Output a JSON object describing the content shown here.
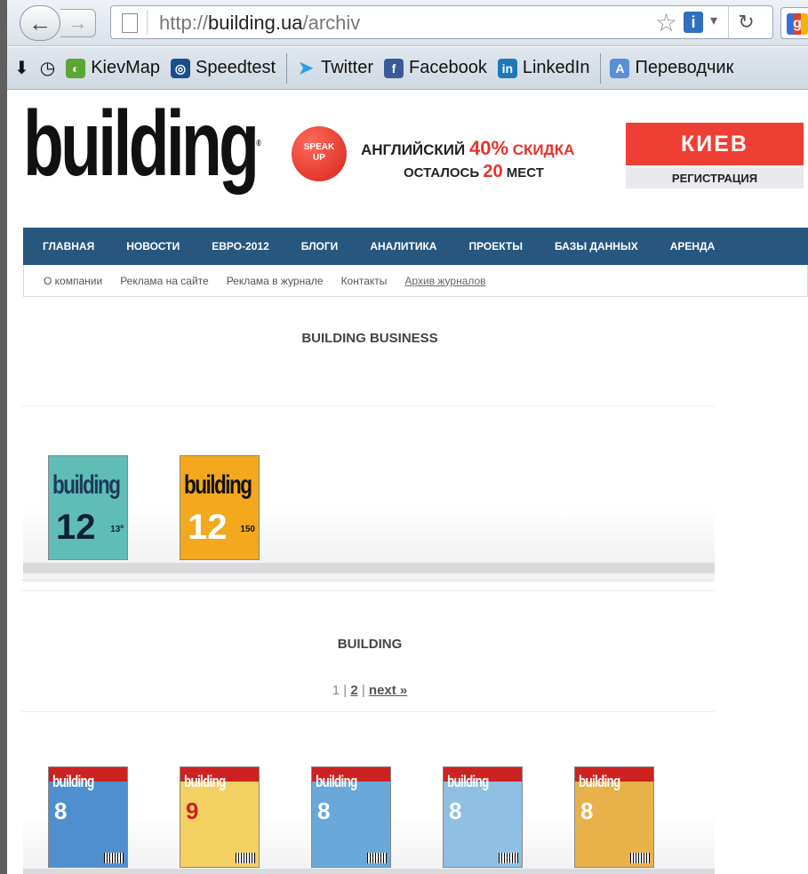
{
  "browser": {
    "url_prefix": "http://",
    "url_domain": "building.ua",
    "url_path": "/archiv",
    "bookmarks": [
      {
        "label": "KievMap",
        "icon": "kievmap-icon"
      },
      {
        "label": "Speedtest",
        "icon": "speedtest-icon"
      },
      {
        "label": "Twitter",
        "icon": "twitter-icon"
      },
      {
        "label": "Facebook",
        "icon": "facebook-icon"
      },
      {
        "label": "LinkedIn",
        "icon": "linkedin-icon"
      },
      {
        "label": "Переводчик",
        "icon": "translate-icon"
      }
    ]
  },
  "site": {
    "logo": "building",
    "banner": {
      "badge_line1": "SPEAK",
      "badge_line2": "UP",
      "line1_a": "АНГЛИЙСКИЙ",
      "line1_discount": "40%",
      "line1_b": "СКИДКА",
      "line2_a": "ОСТАЛОСЬ",
      "line2_num": "20",
      "line2_b": "МЕСТ",
      "city": "КИЕВ",
      "register": "РЕГИСТРАЦИЯ"
    },
    "main_nav": [
      "ГЛАВНАЯ",
      "НОВОСТИ",
      "ЕВРО-2012",
      "БЛОГИ",
      "АНАЛИТИКА",
      "ПРОЕКТЫ",
      "БАЗЫ ДАННЫХ",
      "АРЕНДА"
    ],
    "sub_nav": [
      "О компании",
      "Реклама на сайте",
      "Реклама в журнале",
      "Контакты",
      "Архив журналов"
    ],
    "active_sub_nav": "Архив журналов"
  },
  "sections": {
    "business_title": "BUILDING BUSINESS",
    "business_mags": [
      {
        "title": "building",
        "number": "12",
        "price": "13º",
        "color": "#5fbcb6"
      },
      {
        "title": "building",
        "number": "12",
        "price": "150",
        "color": "#f3a81d"
      }
    ],
    "building_title": "BUILDING",
    "pager": {
      "page1": "1",
      "sep1": "|",
      "page2": "2",
      "sep2": "|",
      "next": "next »"
    },
    "building_mags": [
      {
        "title": "building",
        "number": "8",
        "color": "#4f8fd0"
      },
      {
        "title": "building",
        "number": "9",
        "color": "#f2d061"
      },
      {
        "title": "building",
        "number": "8",
        "color": "#69a8d8"
      },
      {
        "title": "building",
        "number": "8",
        "color": "#8fc0e4"
      },
      {
        "title": "building",
        "number": "8",
        "color": "#e9b14a"
      }
    ]
  }
}
